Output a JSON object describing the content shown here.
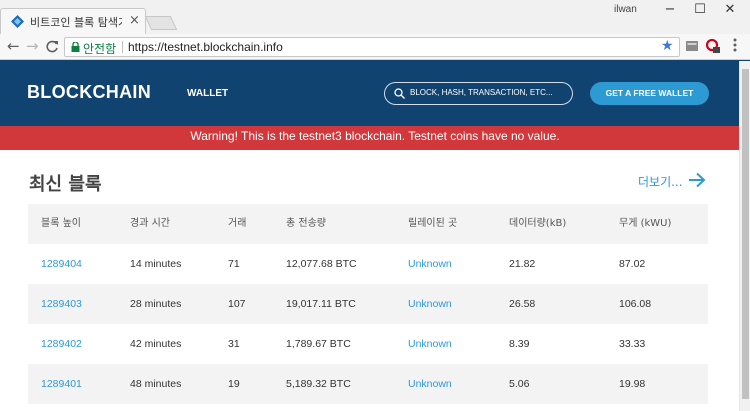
{
  "browser": {
    "tab_title": "비트코인 블록 탐색기 - ",
    "tab_close": "×",
    "user_name": "ilwan",
    "window_buttons": [
      "−",
      "☐",
      "✕"
    ],
    "nav": {
      "back": "←",
      "forward": "→",
      "reload": "C"
    },
    "secure_label": "안전함",
    "url": "https://testnet.blockchain.info",
    "star": "★"
  },
  "site": {
    "logo": "BLOCKCHAIN",
    "nav_wallet": "WALLET",
    "search_placeholder": "BLOCK, HASH, TRANSACTION, ETC...",
    "cta": "GET A FREE WALLET",
    "warning": "Warning! This is the testnet3 blockchain. Testnet coins have no value.",
    "section_title": "최신 블록",
    "more_link": "더보기...",
    "accent_color": "#2e9ad3",
    "header_color": "#10436f",
    "warning_color": "#d0383c"
  },
  "table": {
    "headers": [
      "블록 높이",
      "경과 시간",
      "거래",
      "총 전송량",
      "릴레이된 곳",
      "데이터량(kB)",
      "무게 (kWU)"
    ],
    "rows": [
      [
        "1289404",
        "14 minutes",
        "71",
        "12,077.68 BTC",
        "Unknown",
        "21.82",
        "87.02"
      ],
      [
        "1289403",
        "28 minutes",
        "107",
        "19,017.11 BTC",
        "Unknown",
        "26.58",
        "106.08"
      ],
      [
        "1289402",
        "42 minutes",
        "31",
        "1,789.67 BTC",
        "Unknown",
        "8.39",
        "33.33"
      ],
      [
        "1289401",
        "48 minutes",
        "19",
        "5,189.32 BTC",
        "Unknown",
        "5.06",
        "19.98"
      ]
    ]
  }
}
